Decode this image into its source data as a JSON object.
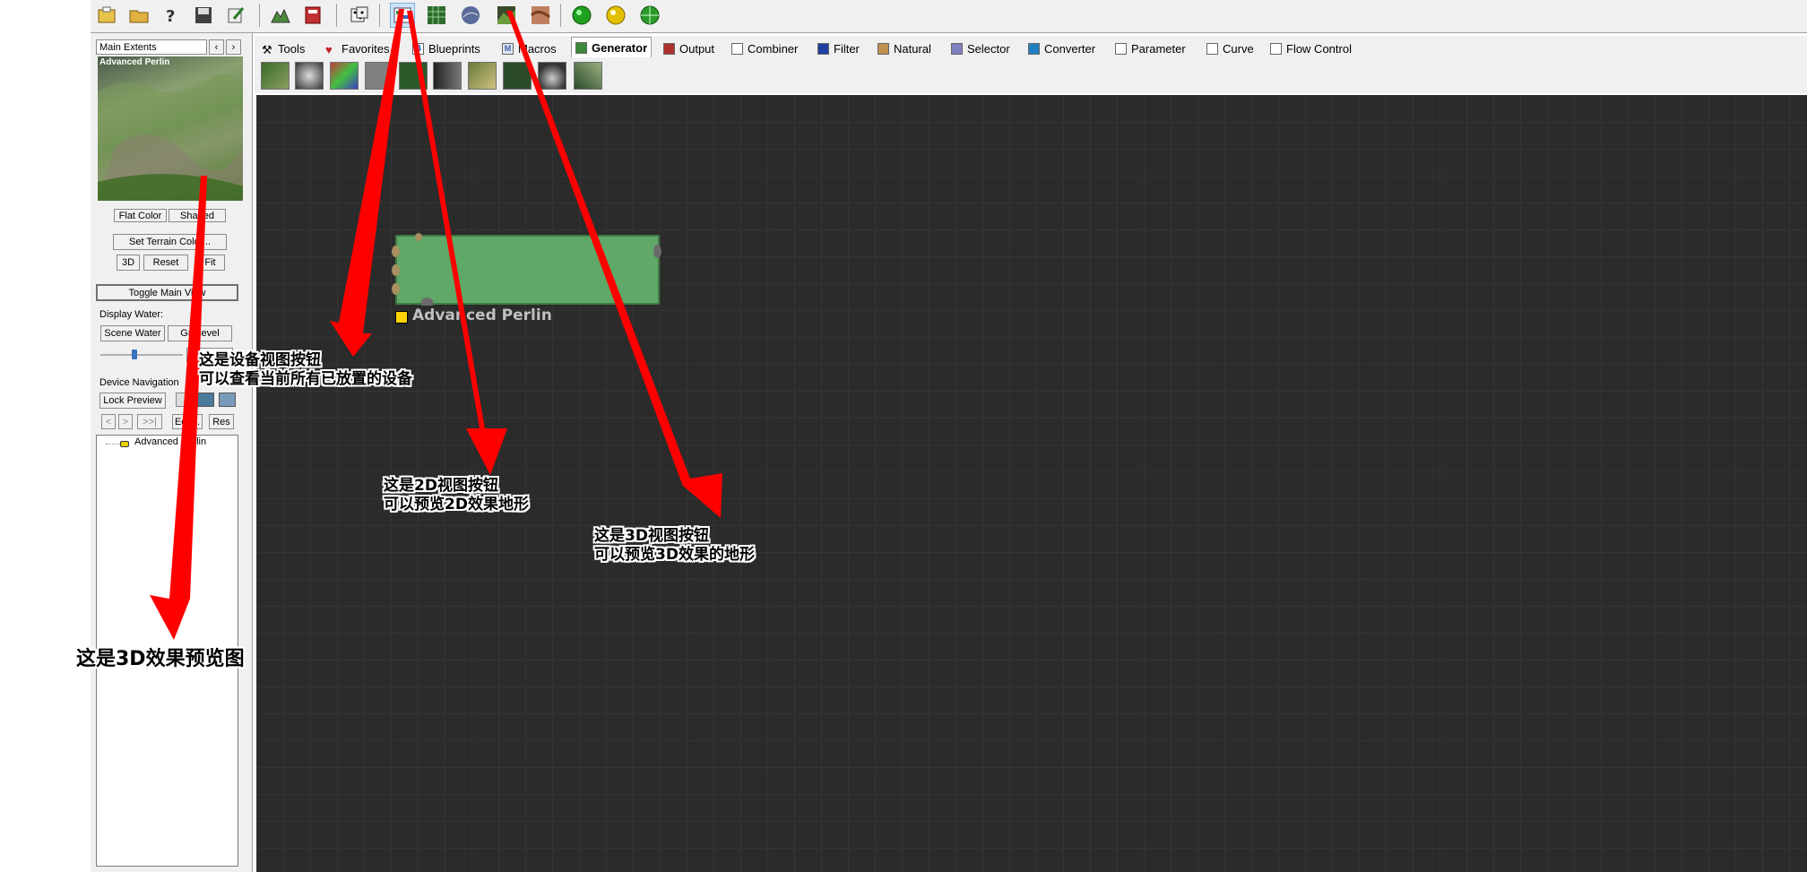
{
  "toolbar": {
    "buttons": [
      "new-project-icon",
      "open-folder-icon",
      "help-icon",
      "save-icon",
      "edit-icon",
      "terrain-export-icon",
      "book-icon",
      "dice-icon",
      "device-view-icon",
      "view-2d-icon",
      "view-3d-icon",
      "texture-view-icon",
      "terrain-image-icon",
      "build-green-icon",
      "build-yellow-icon",
      "globe-green-icon"
    ]
  },
  "left_panel": {
    "extents_select": "Main Extents",
    "preview_title": "Advanced Perlin",
    "flat_color": "Flat Color",
    "shaded": "Shaded",
    "set_terrain_color": "Set Terrain Color...",
    "btn_3d": "3D",
    "btn_reset": "Reset",
    "btn_fit": "Fit",
    "toggle_main_view": "Toggle Main View",
    "display_water_label": "Display Water:",
    "scene_water": "Scene Water",
    "grid_level": "Gridlevel",
    "device_navigation_label": "Device Navigation",
    "lock_preview": "Lock Preview",
    "nav_prev": "<",
    "nav_next": ">",
    "nav_last": ">>|",
    "nav_edit": "Edit...",
    "nav_res": "Res",
    "tree_item": "Advanced Perlin"
  },
  "tabs": [
    {
      "label": "Tools",
      "icon": "tools-icon",
      "color": "#8a6a2a"
    },
    {
      "label": "Favorites",
      "icon": "heart-icon",
      "color": "#c0202a"
    },
    {
      "label": "Blueprints",
      "icon": "blueprint-icon",
      "color": "#2050c0"
    },
    {
      "label": "Macros",
      "icon": "macro-icon",
      "color": "#4060a0"
    },
    {
      "label": "Generator",
      "icon": "generator-icon",
      "color": "#3a8a3a"
    },
    {
      "label": "Output",
      "icon": "output-icon",
      "color": "#b03030"
    },
    {
      "label": "Combiner",
      "icon": "combiner-icon",
      "color": "#303030"
    },
    {
      "label": "Filter",
      "icon": "filter-icon",
      "color": "#2040a0"
    },
    {
      "label": "Natural",
      "icon": "natural-icon",
      "color": "#a07030"
    },
    {
      "label": "Selector",
      "icon": "selector-icon",
      "color": "#5050a0"
    },
    {
      "label": "Converter",
      "icon": "converter-icon",
      "color": "#2080c0"
    },
    {
      "label": "Parameter",
      "icon": "parameter-icon",
      "color": "#303030"
    },
    {
      "label": "Curve",
      "icon": "curve-icon",
      "color": "#303030"
    },
    {
      "label": "Flow Control",
      "icon": "flow-control-icon",
      "color": "#303030"
    }
  ],
  "active_tab": "Generator",
  "node": {
    "title": "Advanced Perlin"
  },
  "annotations": {
    "device_view_line1": "这是设备视图按钮",
    "device_view_line2": "可以查看当前所有已放置的设备",
    "view_2d_line1": "这是2D视图按钮",
    "view_2d_line2": "可以预览2D效果地形",
    "view_3d_line1": "这是3D视图按钮",
    "view_3d_line2": "可以预览3D效果的地形",
    "preview_3d": "这是3D效果预览图"
  },
  "colors": {
    "arrow": "#ff0000",
    "canvas": "#2b2b2b",
    "node": "#5fa867",
    "node_flag": "#ffd400"
  }
}
